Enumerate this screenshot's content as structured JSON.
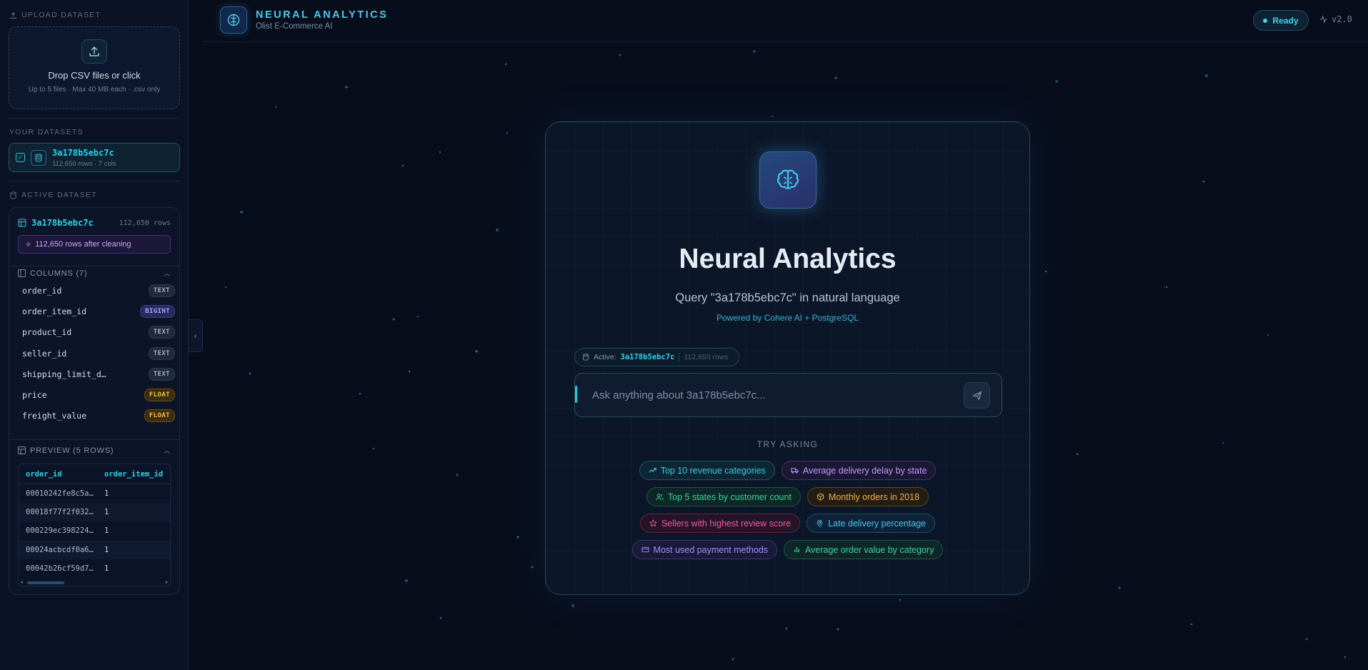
{
  "sidebar": {
    "upload": {
      "section_label": "UPLOAD DATASET",
      "title": "Drop CSV files or click",
      "subtitle": "Up to 5 files · Max 40 MB each · .csv only"
    },
    "datasets": {
      "section_label": "YOUR DATASETS",
      "items": [
        {
          "name": "3a178b5ebc7c",
          "meta": "112,650 rows · 7 cols"
        }
      ]
    },
    "active": {
      "section_label": "ACTIVE DATASET",
      "name": "3a178b5ebc7c",
      "rows": "112,650 rows",
      "cleaning_note": "112,650 rows after cleaning",
      "columns_label": "COLUMNS (7)",
      "columns": [
        {
          "name": "order_id",
          "type": "TEXT"
        },
        {
          "name": "order_item_id",
          "type": "BIGINT"
        },
        {
          "name": "product_id",
          "type": "TEXT"
        },
        {
          "name": "seller_id",
          "type": "TEXT"
        },
        {
          "name": "shipping_limit_d…",
          "type": "TEXT"
        },
        {
          "name": "price",
          "type": "FLOAT"
        },
        {
          "name": "freight_value",
          "type": "FLOAT"
        }
      ],
      "preview_label": "PREVIEW (5 ROWS)",
      "preview_headers": [
        "order_id",
        "order_item_id"
      ],
      "preview_rows": [
        [
          "00010242fe8c5a…",
          "1"
        ],
        [
          "00018f77f2f032…",
          "1"
        ],
        [
          "000229ec398224…",
          "1"
        ],
        [
          "00024acbcdf0a6…",
          "1"
        ],
        [
          "00042b26cf59d7…",
          "1"
        ]
      ]
    }
  },
  "header": {
    "title": "NEURAL ANALYTICS",
    "subtitle": "Olist E-Commerce AI",
    "status": "Ready",
    "version": "v2.0"
  },
  "main": {
    "title": "Neural Analytics",
    "subtitle": "Query \"3a178b5ebc7c\" in natural language",
    "powered": "Powered by Cohere AI + PostgreSQL",
    "active_label": "Active:",
    "active_name": "3a178b5ebc7c",
    "active_rows": "112,650 rows",
    "input_placeholder": "Ask anything about 3a178b5ebc7c...",
    "try_label": "TRY ASKING",
    "suggestions": [
      {
        "label": "Top 10 revenue categories",
        "icon": "trend-up-icon",
        "color": "#39cde4"
      },
      {
        "label": "Average delivery delay by state",
        "icon": "truck-icon",
        "color": "#c29bff"
      },
      {
        "label": "Top 5 states by customer count",
        "icon": "users-icon",
        "color": "#3ed39a"
      },
      {
        "label": "Monthly orders in 2018",
        "icon": "package-icon",
        "color": "#f1b04a"
      },
      {
        "label": "Sellers with highest review score",
        "icon": "star-icon",
        "color": "#f25c9a"
      },
      {
        "label": "Late delivery percentage",
        "icon": "map-pin-icon",
        "color": "#4cc4f2"
      },
      {
        "label": "Most used payment methods",
        "icon": "credit-card-icon",
        "color": "#a78bfa"
      },
      {
        "label": "Average order value by category",
        "icon": "bar-chart-icon",
        "color": "#3ed39a"
      }
    ]
  }
}
